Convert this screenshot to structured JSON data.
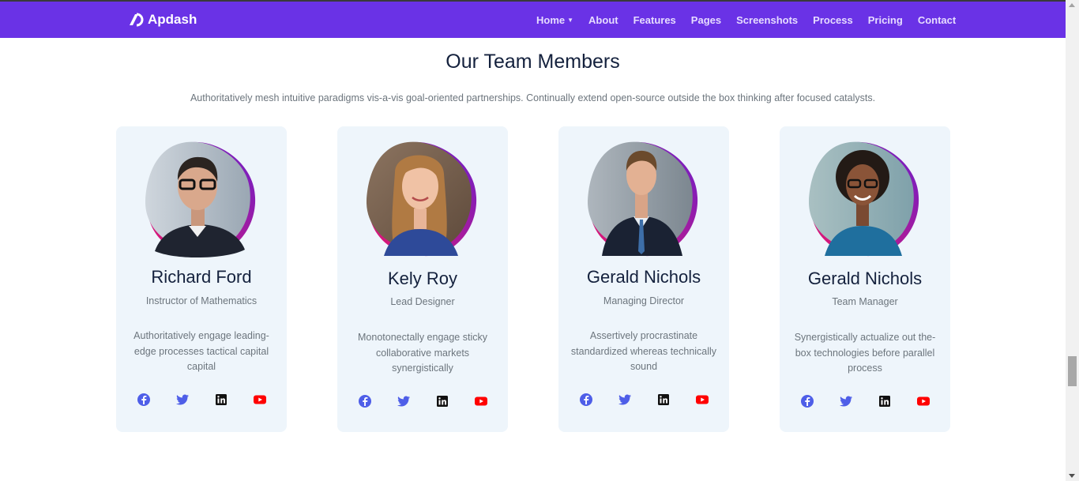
{
  "brand": {
    "name": "Apdash",
    "logo_icon": "apdash-logo-icon"
  },
  "nav": [
    {
      "label": "Home",
      "has_caret": true
    },
    {
      "label": "About"
    },
    {
      "label": "Features"
    },
    {
      "label": "Pages"
    },
    {
      "label": "Screenshots"
    },
    {
      "label": "Process"
    },
    {
      "label": "Pricing"
    },
    {
      "label": "Contact"
    }
  ],
  "section": {
    "title": "Our Team Members",
    "subtitle": "Authoritatively mesh intuitive paradigms vis-a-vis goal-oriented partnerships. Continually extend open-source outside the box thinking after focused catalysts."
  },
  "team": [
    {
      "name": "Richard Ford",
      "role": "Instructor of Mathematics",
      "bio": "Authoritatively engage leading-edge processes tactical capital capital"
    },
    {
      "name": "Kely Roy",
      "role": "Lead Designer",
      "bio": "Monotonectally engage sticky collaborative markets synergistically"
    },
    {
      "name": "Gerald Nichols",
      "role": "Managing Director",
      "bio": "Assertively procrastinate standardized whereas technically sound"
    },
    {
      "name": "Gerald Nichols",
      "role": "Team Manager",
      "bio": "Synergistically actualize out the-box technologies before parallel process"
    }
  ],
  "social_icons": [
    "facebook-icon",
    "twitter-icon",
    "linkedin-icon",
    "youtube-icon"
  ],
  "colors": {
    "navbar": "#6a32e6",
    "card_bg": "#eef5fb",
    "heading": "#14213d",
    "muted": "#6c757d",
    "facebook": "#4e5ee8",
    "twitter": "#4e5ee8",
    "linkedin": "#111111",
    "youtube": "#ff0000"
  }
}
